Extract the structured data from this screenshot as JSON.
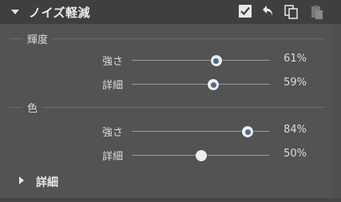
{
  "header": {
    "title": "ノイズ軽減",
    "icons": [
      "checkbox-icon",
      "undo-icon",
      "copy-icon",
      "paste-icon"
    ]
  },
  "luminance": {
    "label": "輝度",
    "strength": {
      "label": "強さ",
      "value": "61%",
      "level": 0.61
    },
    "detail": {
      "label": "詳細",
      "value": "59%",
      "level": 0.59
    }
  },
  "color": {
    "label": "色",
    "strength": {
      "label": "強さ",
      "value": "84%",
      "level": 0.84
    },
    "detail": {
      "label": "詳細",
      "value": "50%",
      "level": 0.5
    }
  },
  "details_section": {
    "label": "詳細"
  },
  "colors": {
    "panel_bg": "#535353",
    "header_bg": "#3f3f3f",
    "thumb_dot": "#4d6a8c"
  }
}
